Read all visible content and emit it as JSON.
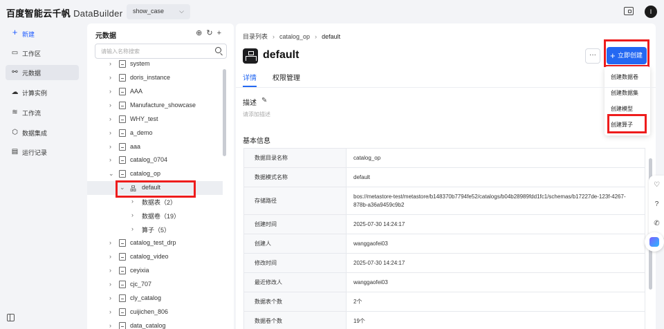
{
  "topbar": {
    "brand": "百度智能云千帆",
    "app": "DataBuilder",
    "workspace": "show_case",
    "avatar_letter": "I"
  },
  "sidenav": {
    "new_label": "新建",
    "items": [
      {
        "label": "工作区",
        "icon": "folder-icon"
      },
      {
        "label": "元数据",
        "icon": "metadata-icon"
      },
      {
        "label": "计算实例",
        "icon": "cloud-icon"
      },
      {
        "label": "工作流",
        "icon": "workflow-icon"
      },
      {
        "label": "数据集成",
        "icon": "integration-icon"
      },
      {
        "label": "运行记录",
        "icon": "record-icon"
      }
    ]
  },
  "tree": {
    "title": "元数据",
    "search_placeholder": "请输入名称搜索",
    "rows": [
      {
        "label": "system"
      },
      {
        "label": "doris_instance"
      },
      {
        "label": "AAA"
      },
      {
        "label": "Manufacture_showcase"
      },
      {
        "label": "WHY_test"
      },
      {
        "label": "a_demo"
      },
      {
        "label": "aaa"
      },
      {
        "label": "catalog_0704"
      },
      {
        "label": "catalog_op"
      },
      {
        "label": "default"
      },
      {
        "label": "数据表（2）"
      },
      {
        "label": "数据卷（19）"
      },
      {
        "label": "算子（5）"
      },
      {
        "label": "catalog_test_drp"
      },
      {
        "label": "catalog_video"
      },
      {
        "label": "ceyixia"
      },
      {
        "label": "cjc_707"
      },
      {
        "label": "cly_catalog"
      },
      {
        "label": "cuijichen_806"
      },
      {
        "label": "data_catalog"
      }
    ]
  },
  "breadcrumb": {
    "root": "目录列表",
    "catalog": "catalog_op",
    "current": "default"
  },
  "header": {
    "title": "default",
    "more": "···",
    "create_label": "立即创建"
  },
  "dropdown": {
    "items": [
      "创建数据卷",
      "创建数据集",
      "创建模型",
      "创建算子"
    ]
  },
  "tabs": [
    "详情",
    "权限管理"
  ],
  "description": {
    "title": "描述",
    "placeholder": "请添加描述"
  },
  "basic_info": {
    "title": "基本信息",
    "rows": [
      {
        "key": "数据目录名称",
        "value": "catalog_op"
      },
      {
        "key": "数据模式名称",
        "value": "default"
      },
      {
        "key": "存储路径",
        "value": "bos://metastore-test/metastore/b148370b7794fe52/catalogs/b04b28989fdd1fc1/schemas/b17227de-123f-4267-878b-a36a9459c9b2"
      },
      {
        "key": "创建时间",
        "value": "2025-07-30 14:24:17"
      },
      {
        "key": "创建人",
        "value": "wanggaofei03"
      },
      {
        "key": "修改时间",
        "value": "2025-07-30 14:24:17"
      },
      {
        "key": "最近修改人",
        "value": "wanggaofei03"
      },
      {
        "key": "数据表个数",
        "value": "2个"
      },
      {
        "key": "数据卷个数",
        "value": "19个"
      }
    ]
  },
  "colors": {
    "accent": "#2468f2",
    "highlight": "#ee1c1c"
  }
}
